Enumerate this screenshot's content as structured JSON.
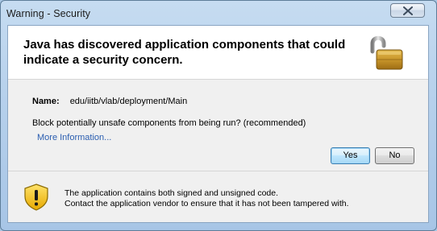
{
  "window": {
    "title": "Warning - Security",
    "close_icon": "close-icon"
  },
  "header": {
    "headline": "Java has discovered application components that could indicate a security concern.",
    "icon": "unlocked-padlock-icon"
  },
  "details": {
    "name_label": "Name:",
    "name_value": "edu/iitb/vlab/deployment/Main",
    "question": "Block potentially unsafe components from being run? (recommended)",
    "more_info_link": "More Information..."
  },
  "buttons": {
    "yes_label": "Yes",
    "no_label": "No"
  },
  "footer": {
    "icon": "warning-shield-icon",
    "line1": "The application contains both signed and unsigned code.",
    "line2": "Contact the application vendor to ensure that it has not been tampered with."
  },
  "colors": {
    "link": "#2a5db0",
    "frame": "#b7d1ec",
    "panel": "#f0f0f0",
    "header": "#ffffff"
  }
}
